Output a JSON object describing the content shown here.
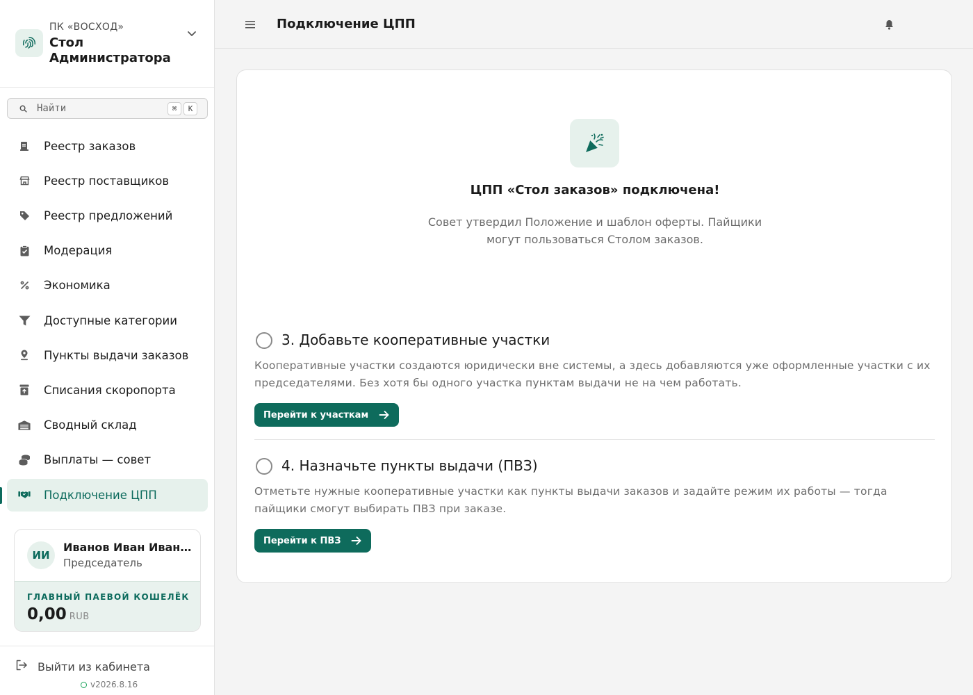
{
  "org": {
    "subtitle": "ПК «ВОСХОД»",
    "name": "Стол Администратора"
  },
  "search": {
    "placeholder": "Найти",
    "shortcut_mod": "⌘",
    "shortcut_key": "K"
  },
  "sidebar": {
    "items": [
      {
        "label": "Реестр заказов",
        "icon": "receipt-icon"
      },
      {
        "label": "Реестр поставщиков",
        "icon": "store-icon"
      },
      {
        "label": "Реестр предложений",
        "icon": "tag-icon"
      },
      {
        "label": "Модерация",
        "icon": "clipboard-check-icon"
      },
      {
        "label": "Экономика",
        "icon": "percent-icon"
      },
      {
        "label": "Доступные категории",
        "icon": "filter-icon"
      },
      {
        "label": "Пункты выдачи заказов",
        "icon": "map-pin-icon"
      },
      {
        "label": "Списания скоропорта",
        "icon": "archive-up-icon"
      },
      {
        "label": "Сводный склад",
        "icon": "warehouse-icon"
      },
      {
        "label": "Выплаты — совет",
        "icon": "coins-icon"
      },
      {
        "label": "Подключение ЦПП",
        "icon": "handshake-icon",
        "active": true
      }
    ]
  },
  "user": {
    "initials": "ИИ",
    "name": "Иванов Иван Иванович",
    "role": "Председатель",
    "wallet_label": "ГЛАВНЫЙ ПАЕВОЙ КОШЕЛЁК",
    "wallet_amount": "0,00",
    "wallet_currency": "RUB"
  },
  "footer": {
    "logout_label": "Выйти из кабинета",
    "version": "v2026.8.16"
  },
  "header": {
    "title": "Подключение ЦПП"
  },
  "main": {
    "hero_title": "ЦПП «Стол заказов» подключена!",
    "hero_desc": "Совет утвердил Положение и шаблон оферты. Пайщики могут пользоваться Столом заказов.",
    "steps": [
      {
        "title": "3. Добавьте кооперативные участки",
        "desc": "Кооперативные участки создаются юридически вне системы, а здесь добавляются уже оформленные участки с их председателями. Без хотя бы одного участка пунктам выдачи не на чем работать.",
        "button": "Перейти к участкам"
      },
      {
        "title": "4. Назначьте пункты выдачи (ПВЗ)",
        "desc": "Отметьте нужные кооперативные участки как пункты выдачи заказов и задайте режим их работы — тогда пайщики смогут выбирать ПВЗ при заказе.",
        "button": "Перейти к ПВЗ"
      }
    ]
  },
  "colors": {
    "accent": "#0e6b5c",
    "accent_soft": "#e6f1ec",
    "status_dot": "#19a35a"
  }
}
